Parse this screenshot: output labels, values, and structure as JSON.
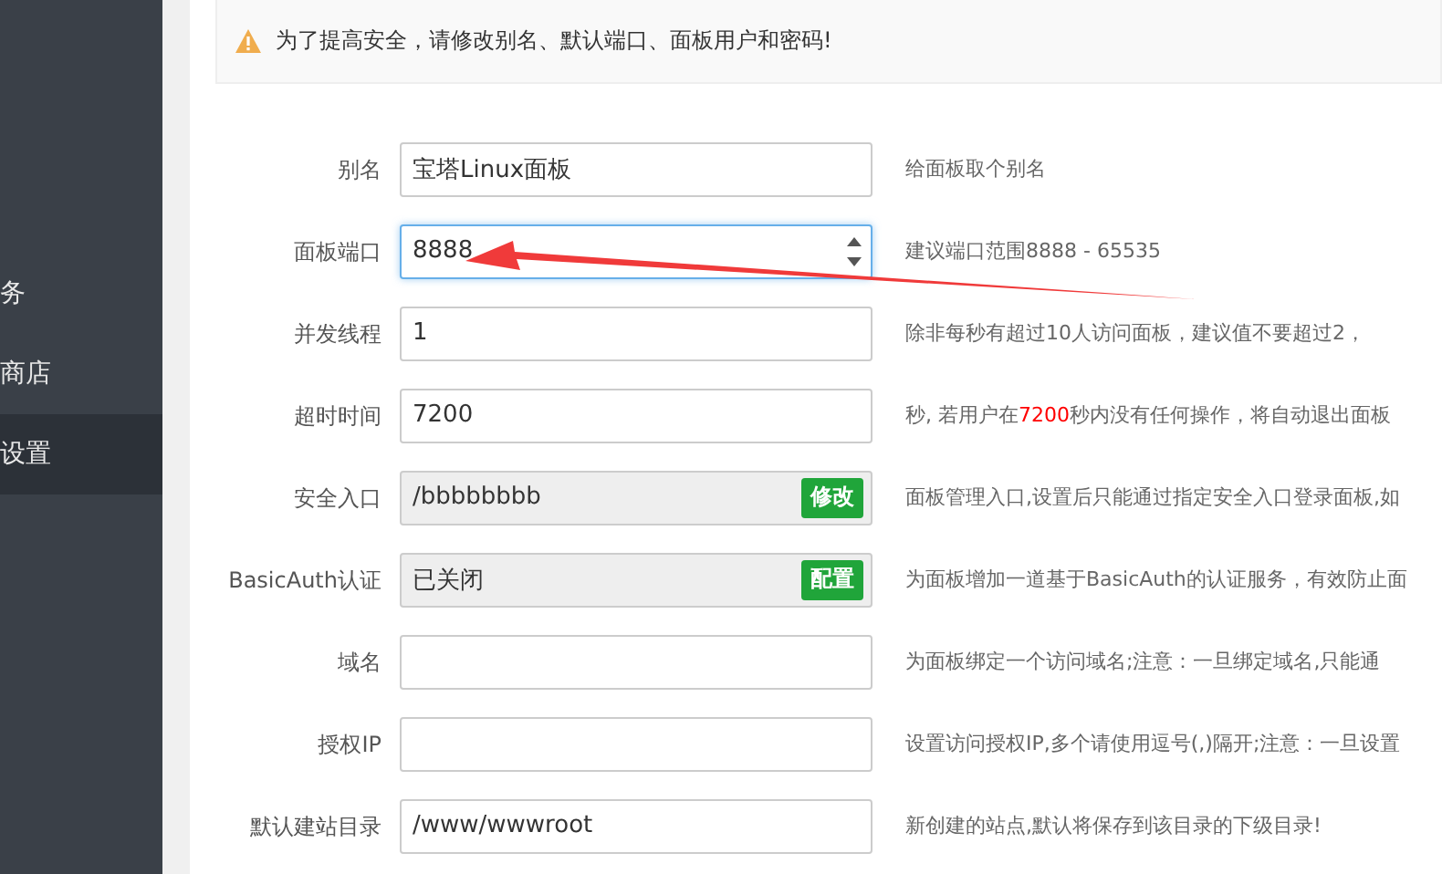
{
  "sidebar": {
    "items": [
      {
        "label": "务",
        "selected": false
      },
      {
        "label": "商店",
        "selected": false
      },
      {
        "label": "设置",
        "selected": true
      }
    ]
  },
  "warning": {
    "text": "为了提高安全，请修改别名、默认端口、面板用户和密码!"
  },
  "form": {
    "rows": [
      {
        "label": "别名",
        "kind": "text",
        "value": "宝塔Linux面板",
        "focused": false,
        "description": [
          {
            "text": "给面板取个别名",
            "highlight": false
          }
        ]
      },
      {
        "label": "面板端口",
        "kind": "number",
        "value": "8888",
        "focused": true,
        "description": [
          {
            "text": "建议端口范围8888 - 65535",
            "highlight": false
          }
        ]
      },
      {
        "label": "并发线程",
        "kind": "text",
        "value": "1",
        "focused": false,
        "description": [
          {
            "text": "除非每秒有超过10人访问面板，建议值不要超过2，",
            "highlight": false
          }
        ]
      },
      {
        "label": "超时时间",
        "kind": "text",
        "value": "7200",
        "focused": false,
        "description": [
          {
            "text": "秒, 若用户在",
            "highlight": false
          },
          {
            "text": "7200",
            "highlight": true
          },
          {
            "text": "秒内没有任何操作，将自动退出面板",
            "highlight": false
          }
        ]
      },
      {
        "label": "安全入口",
        "kind": "locked",
        "value": "/bbbbbbbb",
        "button": "修改",
        "focused": false,
        "description": [
          {
            "text": "面板管理入口,设置后只能通过指定安全入口登录面板,如",
            "highlight": false
          }
        ]
      },
      {
        "label": "BasicAuth认证",
        "kind": "locked",
        "value": "已关闭",
        "button": "配置",
        "focused": false,
        "description": [
          {
            "text": "为面板增加一道基于BasicAuth的认证服务，有效防止面",
            "highlight": false
          }
        ]
      },
      {
        "label": "域名",
        "kind": "text",
        "value": "",
        "focused": false,
        "description": [
          {
            "text": "为面板绑定一个访问域名;注意：一旦绑定域名,只能通",
            "highlight": false
          }
        ]
      },
      {
        "label": "授权IP",
        "kind": "text",
        "value": "",
        "focused": false,
        "description": [
          {
            "text": "设置访问授权IP,多个请使用逗号(,)隔开;注意：一旦设置",
            "highlight": false
          }
        ]
      },
      {
        "label": "默认建站目录",
        "kind": "text",
        "value": "/www/wwwroot",
        "focused": false,
        "description": [
          {
            "text": "新创建的站点,默认将保存到该目录的下级目录!",
            "highlight": false
          }
        ]
      }
    ]
  }
}
